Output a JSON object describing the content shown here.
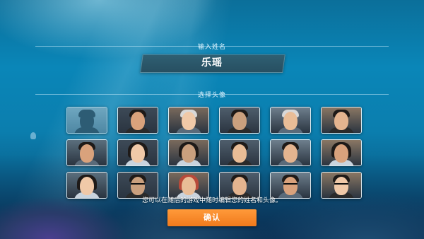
{
  "name_section": {
    "label": "输入姓名",
    "current_name": "乐瑶"
  },
  "avatar_section": {
    "label": "选择头像",
    "avatars": [
      {
        "kind": "silhouette"
      },
      {
        "kind": "man"
      },
      {
        "kind": "old-man"
      },
      {
        "kind": "old-woman"
      },
      {
        "kind": "old-man-white-hair"
      },
      {
        "kind": "man-smiling"
      },
      {
        "kind": "man"
      },
      {
        "kind": "woman"
      },
      {
        "kind": "woman"
      },
      {
        "kind": "man"
      },
      {
        "kind": "man"
      },
      {
        "kind": "woman"
      },
      {
        "kind": "woman"
      },
      {
        "kind": "man-glasses"
      },
      {
        "kind": "woman-red-hair"
      },
      {
        "kind": "man"
      },
      {
        "kind": "man-glasses"
      },
      {
        "kind": "man-glasses"
      }
    ]
  },
  "hint_text": "您可以在随后的游戏中随时编辑您的姓名和头像。",
  "confirm_button": {
    "label": "确认"
  },
  "colors": {
    "confirm": "#f58a2a",
    "name_box": "#2c5a6c",
    "ocean": "#0a86b8"
  }
}
